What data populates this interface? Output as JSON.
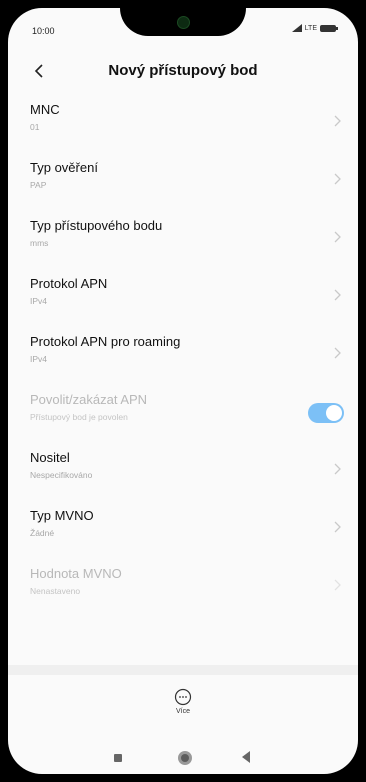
{
  "status_bar": {
    "time": "10:00",
    "network": "LTE",
    "icons": [
      "signal-icon",
      "battery-icon"
    ]
  },
  "header": {
    "title": "Nový přístupový bod",
    "back_icon": "back-arrow-icon"
  },
  "settings": [
    {
      "title": "MNC",
      "value": "01"
    },
    {
      "title": "Typ ověření",
      "value": "PAP"
    },
    {
      "title": "Typ přístupového bodu",
      "value": "mms"
    },
    {
      "title": "Protokol APN",
      "value": "IPv4"
    },
    {
      "title": "Protokol APN pro roaming",
      "value": "IPv4"
    },
    {
      "title": "Povolit/zakázat APN",
      "value": "Přístupový bod je povolen",
      "toggle": true,
      "enabled": true
    },
    {
      "title": "Nositel",
      "value": "Nespecifikováno"
    },
    {
      "title": "Typ MVNO",
      "value": "Žádné"
    },
    {
      "title": "Hodnota MVNO",
      "value": "Nenastaveno"
    }
  ],
  "more": {
    "label": "Více",
    "icon": "more-dots-icon"
  },
  "colors": {
    "toggle_on": "#7cc0f6",
    "background": "#fafafa"
  }
}
